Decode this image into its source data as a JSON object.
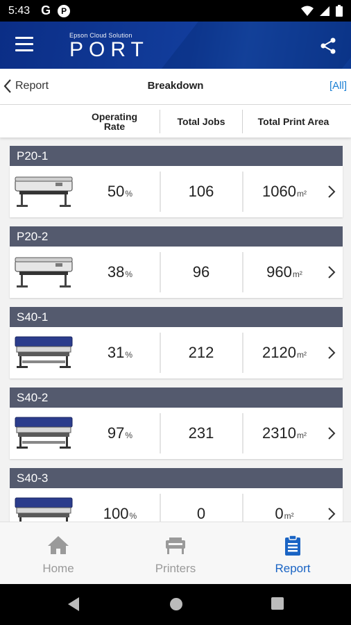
{
  "status_bar": {
    "time": "5:43",
    "g_label": "G",
    "p_label": "P"
  },
  "header": {
    "brand_sub": "Epson Cloud Solution",
    "brand_name": "PORT"
  },
  "nav": {
    "back_label": "Report",
    "title": "Breakdown",
    "filter_label": "[All]"
  },
  "columns": {
    "operating_rate": "Operating\nRate",
    "total_jobs": "Total Jobs",
    "total_print_area": "Total Print Area"
  },
  "printers": [
    {
      "name": "P20-1",
      "model": "p-series",
      "rate": "50",
      "rate_unit": "%",
      "jobs": "106",
      "area": "1060",
      "area_unit": "m²"
    },
    {
      "name": "P20-2",
      "model": "p-series",
      "rate": "38",
      "rate_unit": "%",
      "jobs": "96",
      "area": "960",
      "area_unit": "m²"
    },
    {
      "name": "S40-1",
      "model": "s-series",
      "rate": "31",
      "rate_unit": "%",
      "jobs": "212",
      "area": "2120",
      "area_unit": "m²"
    },
    {
      "name": "S40-2",
      "model": "s-series",
      "rate": "97",
      "rate_unit": "%",
      "jobs": "231",
      "area": "2310",
      "area_unit": "m²"
    },
    {
      "name": "S40-3",
      "model": "s-series",
      "rate": "100",
      "rate_unit": "%",
      "jobs": "0",
      "area": "0",
      "area_unit": "m²"
    }
  ],
  "tabs": [
    {
      "label": "Home",
      "icon": "home-icon",
      "active": false
    },
    {
      "label": "Printers",
      "icon": "printer-icon",
      "active": false
    },
    {
      "label": "Report",
      "icon": "clipboard-icon",
      "active": true
    }
  ],
  "colors": {
    "header_blue": "#0b2e86",
    "card_title": "#545a6e",
    "accent": "#1a64c4",
    "filter_link": "#1a7fd4"
  }
}
